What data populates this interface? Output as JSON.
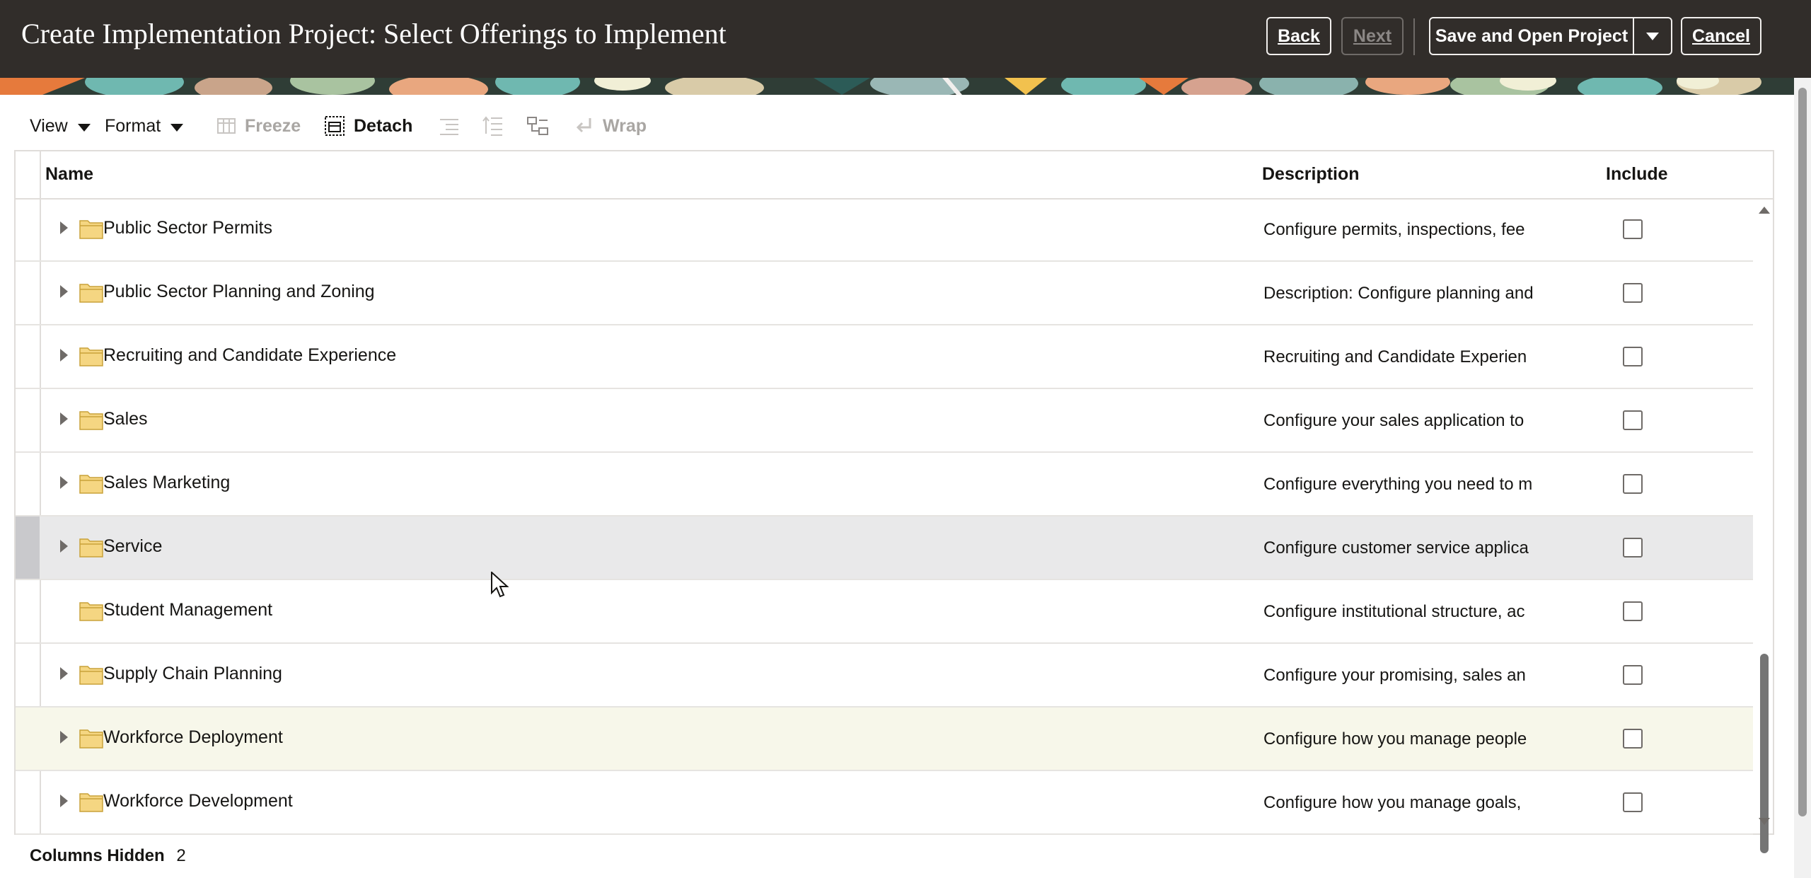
{
  "header": {
    "title": "Create Implementation Project: Select Offerings to Implement",
    "back_label": "Back",
    "next_label": "Next",
    "save_label": "Save and Open Project",
    "cancel_label": "Cancel"
  },
  "toolbar": {
    "view_label": "View",
    "format_label": "Format",
    "freeze_label": "Freeze",
    "detach_label": "Detach",
    "wrap_label": "Wrap"
  },
  "table": {
    "columns": [
      "Name",
      "Description",
      "Include"
    ],
    "rows": [
      {
        "name": "Public Sector Permits",
        "description": "Configure permits, inspections, fee",
        "include": false,
        "expandable": true
      },
      {
        "name": "Public Sector Planning and Zoning",
        "description": "Description: Configure planning and",
        "include": false,
        "expandable": true
      },
      {
        "name": "Recruiting and Candidate Experience",
        "description": "Recruiting and Candidate Experien",
        "include": false,
        "expandable": true
      },
      {
        "name": "Sales",
        "description": "Configure your sales application to",
        "include": false,
        "expandable": true
      },
      {
        "name": "Sales Marketing",
        "description": "Configure everything you need to m",
        "include": false,
        "expandable": true
      },
      {
        "name": "Service",
        "description": "Configure customer service applica",
        "include": false,
        "expandable": true
      },
      {
        "name": "Student Management",
        "description": "Configure institutional structure, ac",
        "include": false,
        "expandable": false
      },
      {
        "name": "Supply Chain Planning",
        "description": "Configure your promising, sales an",
        "include": false,
        "expandable": true
      },
      {
        "name": "Workforce Deployment",
        "description": "Configure how you manage people",
        "include": false,
        "expandable": true
      },
      {
        "name": "Workforce Development",
        "description": "Configure how you manage goals,",
        "include": false,
        "expandable": true
      }
    ]
  },
  "footer": {
    "columns_hidden_label": "Columns Hidden",
    "columns_hidden_value": "2"
  },
  "colors": {
    "header_bg": "#312d2a",
    "selected_row": "#e9e9ea",
    "hover_row": "#f7f7ea",
    "folder": "#f5d682"
  }
}
